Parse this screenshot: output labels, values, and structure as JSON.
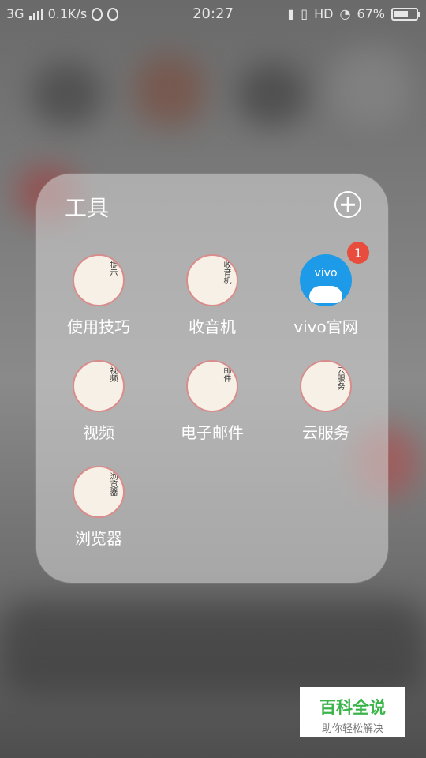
{
  "statusbar": {
    "network": "3G",
    "speed": "0.1K/s",
    "time": "20:27",
    "hd": "HD",
    "battery": "67%",
    "battery_level": 0.67
  },
  "folder": {
    "title": "工具",
    "apps": [
      {
        "label": "使用技巧",
        "glyph": "提示",
        "icon": "tips-book-icon"
      },
      {
        "label": "收音机",
        "glyph": "收音机",
        "icon": "radio-icon"
      },
      {
        "label": "vivo官网",
        "glyph": "vivo",
        "icon": "vivo-icon",
        "badge": "1"
      },
      {
        "label": "视频",
        "glyph": "视频",
        "icon": "umbrella-icon"
      },
      {
        "label": "电子邮件",
        "glyph": "邮件",
        "icon": "mail-scroll-icon"
      },
      {
        "label": "云服务",
        "glyph": "云服务",
        "icon": "lantern-icon"
      },
      {
        "label": "浏览器",
        "glyph": "浏览器",
        "icon": "hairpin-icon"
      }
    ]
  },
  "watermark": {
    "title": "百科全说",
    "subtitle": "助你轻松解决"
  },
  "colors": {
    "badge": "#e74c3c",
    "vivo_blue": "#1e9be8",
    "watermark_green": "#3bb54a"
  }
}
